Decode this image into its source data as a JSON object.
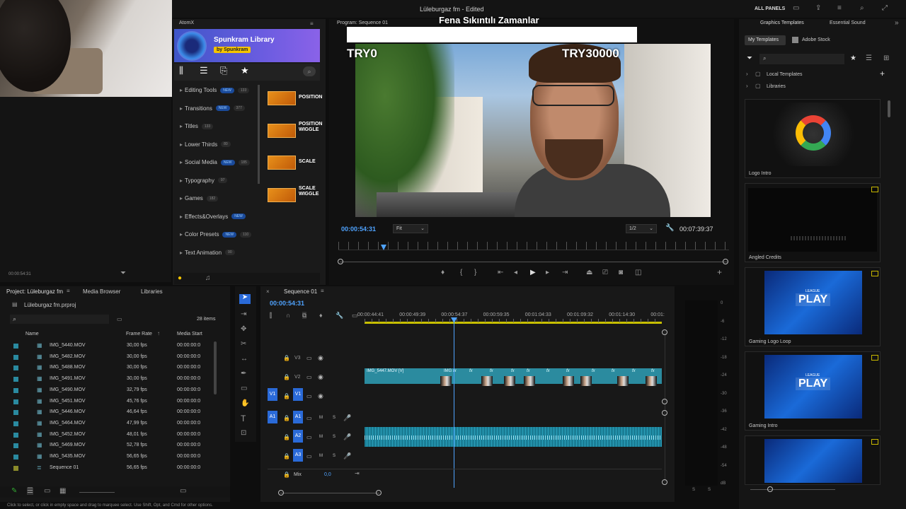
{
  "app": {
    "title": "Lüleburgaz fm - Edited",
    "all_panels": "ALL PANELS"
  },
  "atomx": {
    "panel_title": "AtomX",
    "library_name": "Spunkram Library",
    "by": "by Spunkram",
    "categories": [
      {
        "label": "Editing Tools",
        "badge": "NEW",
        "count": "133"
      },
      {
        "label": "Transitions",
        "badge": "NEW",
        "count": "377"
      },
      {
        "label": "Titles",
        "badge": "",
        "count": "133"
      },
      {
        "label": "Lower Thirds",
        "badge": "",
        "count": "80"
      },
      {
        "label": "Social Media",
        "badge": "NEW",
        "count": "185"
      },
      {
        "label": "Typography",
        "badge": "",
        "count": "97"
      },
      {
        "label": "Games",
        "badge": "",
        "count": "182"
      },
      {
        "label": "Effects&Overlays",
        "badge": "NEW",
        "count": ""
      },
      {
        "label": "Color Presets",
        "badge": "NEW",
        "count": "110"
      },
      {
        "label": "Text Animation",
        "badge": "",
        "count": "90"
      }
    ],
    "presets": [
      {
        "label1": "POSITION",
        "label2": ""
      },
      {
        "label1": "POSITION",
        "label2": "WIGGLE"
      },
      {
        "label1": "SCALE",
        "label2": ""
      },
      {
        "label1": "SCALE",
        "label2": "WIGGLE"
      }
    ]
  },
  "webcam_timecode": "00:00:54:31",
  "program": {
    "tab": "Program: Sequence 01",
    "title_overlay": "Fena Sıkıntılı Zamanlar",
    "left_label": "TRY0",
    "right_label": "TRY30000",
    "timecode": "00:00:54:31",
    "fit": "Fit",
    "resolution": "1/2",
    "duration": "00:07:39:37"
  },
  "graphics": {
    "tabs": [
      "Graphics Templates",
      "Essential Sound"
    ],
    "subtabs": [
      "My Templates",
      "Adobe Stock"
    ],
    "tree": [
      "Local Templates",
      "Libraries"
    ],
    "templates": [
      "Logo Intro",
      "Angled Credits",
      "Gaming Logo Loop",
      "Gaming Intro",
      ""
    ],
    "play_text": "PLAY",
    "league_text": "LEAGUE"
  },
  "project": {
    "tabs": [
      "Project: Lüleburgaz fm",
      "Media Browser",
      "Libraries"
    ],
    "file": "Lüleburgaz fm.prproj",
    "items_count": "28 items",
    "columns": [
      "Name",
      "Frame Rate",
      "Media Start"
    ],
    "rows": [
      {
        "name": "IMG_5440.MOV",
        "fps": "30,00 fps",
        "start": "00:00:00:0"
      },
      {
        "name": "IMG_5482.MOV",
        "fps": "30,00 fps",
        "start": "00:00:00:0"
      },
      {
        "name": "IMG_5488.MOV",
        "fps": "30,00 fps",
        "start": "00:00:00:0"
      },
      {
        "name": "IMG_5491.MOV",
        "fps": "30,00 fps",
        "start": "00:00:00:0"
      },
      {
        "name": "IMG_5490.MOV",
        "fps": "32,79 fps",
        "start": "00:00:00:0"
      },
      {
        "name": "IMG_5451.MOV",
        "fps": "45,76 fps",
        "start": "00:00:00:0"
      },
      {
        "name": "IMG_5446.MOV",
        "fps": "46,64 fps",
        "start": "00:00:00:0"
      },
      {
        "name": "IMG_5464.MOV",
        "fps": "47,99 fps",
        "start": "00:00:00:0"
      },
      {
        "name": "IMG_5452.MOV",
        "fps": "48,01 fps",
        "start": "00:00:00:0"
      },
      {
        "name": "IMG_5469.MOV",
        "fps": "52,78 fps",
        "start": "00:00:00:0"
      },
      {
        "name": "IMG_5435.MOV",
        "fps": "56,65 fps",
        "start": "00:00:00:0"
      },
      {
        "name": "Sequence 01",
        "fps": "56,65 fps",
        "start": "00:00:00:0"
      }
    ]
  },
  "timeline": {
    "tab": "Sequence 01",
    "timecode": "00:00:54:31",
    "ruler": [
      "00:00:44:41",
      "00:00:49:39",
      "00:00:54:37",
      "00:00:59:35",
      "00:01:04:33",
      "00:01:09:32",
      "00:01:14:30",
      "00:01:"
    ],
    "tracks_video": [
      "V3",
      "V2",
      "V1"
    ],
    "tracks_audio": [
      "A1",
      "A2",
      "A3"
    ],
    "mix_label": "Mix",
    "mix_value": "0,0",
    "clip_name": "IMG_5447.MOV [V]",
    "clip_short": "IMG"
  },
  "meter_scale": [
    "0",
    "-6",
    "-12",
    "-18",
    "-24",
    "-30",
    "-36",
    "-42",
    "-48",
    "-54",
    "dB"
  ],
  "meter_bottom": [
    "S",
    "S"
  ],
  "status": "Click to select, or click in empty space and drag to marquee select. Use Shift, Opt, and Cmd for other options."
}
